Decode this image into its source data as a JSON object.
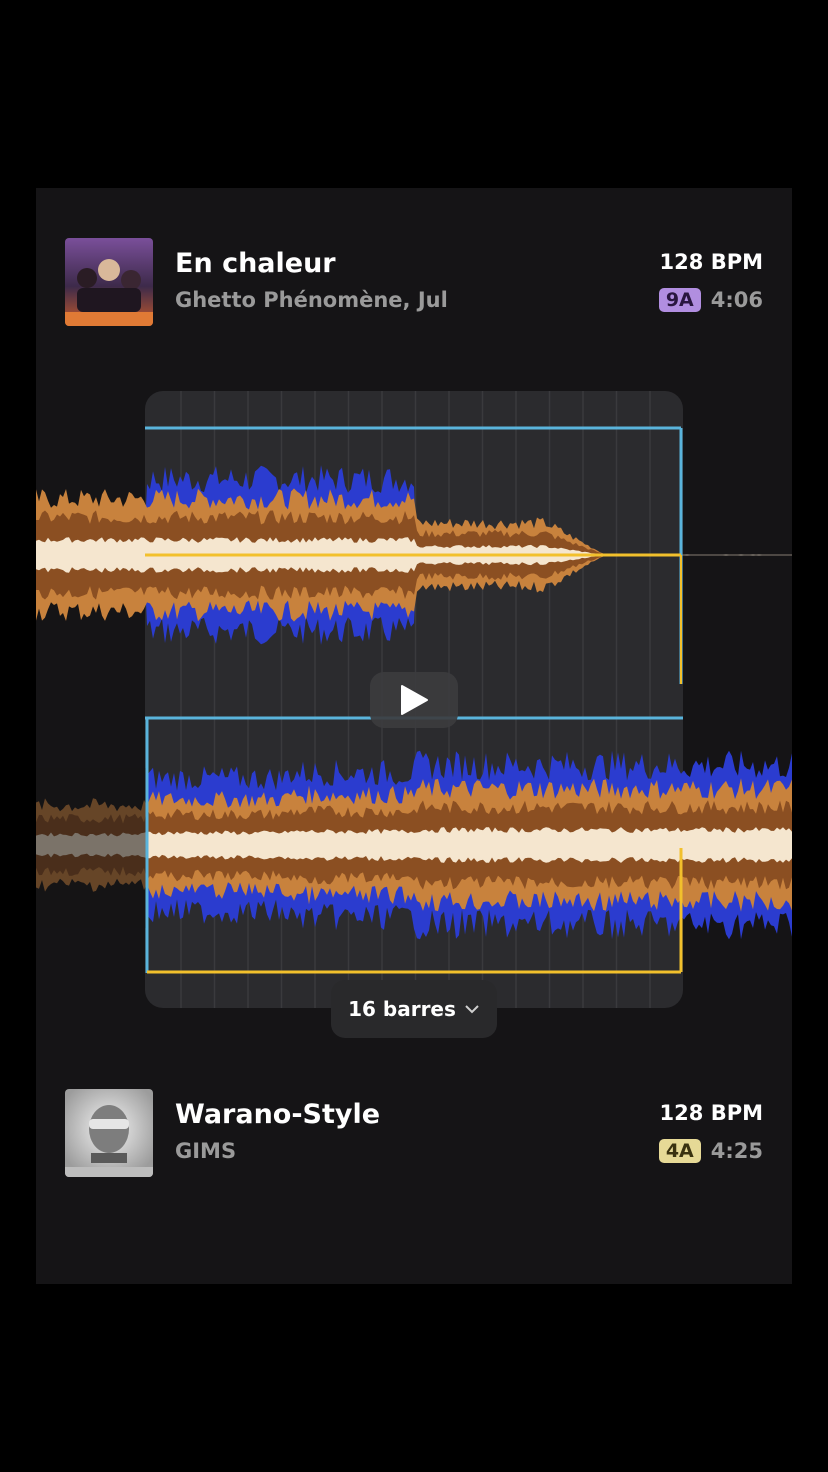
{
  "colors": {
    "background": "#000000",
    "card": "#151416",
    "wave_light": "#c8823d",
    "wave_mid": "#8b4f22",
    "wave_core": "#f5e6cf",
    "wave_blue": "#2b3ccf",
    "cue_blue": "#5ab4dc",
    "cue_yellow": "#f2c02c"
  },
  "tracks": [
    {
      "title": "En chaleur",
      "artist": "Ghetto Phénomène, Jul",
      "bpm": "128 BPM",
      "key": "9A",
      "key_color": "#b18ee0",
      "duration": "4:06"
    },
    {
      "title": "Warano-Style",
      "artist": "GIMS",
      "bpm": "128 BPM",
      "key": "4A",
      "key_color": "#e6d996",
      "duration": "4:25"
    }
  ],
  "editor": {
    "bars_label": "16 barres",
    "play_icon": "play-icon",
    "chevron_icon": "chevron-down-icon"
  }
}
